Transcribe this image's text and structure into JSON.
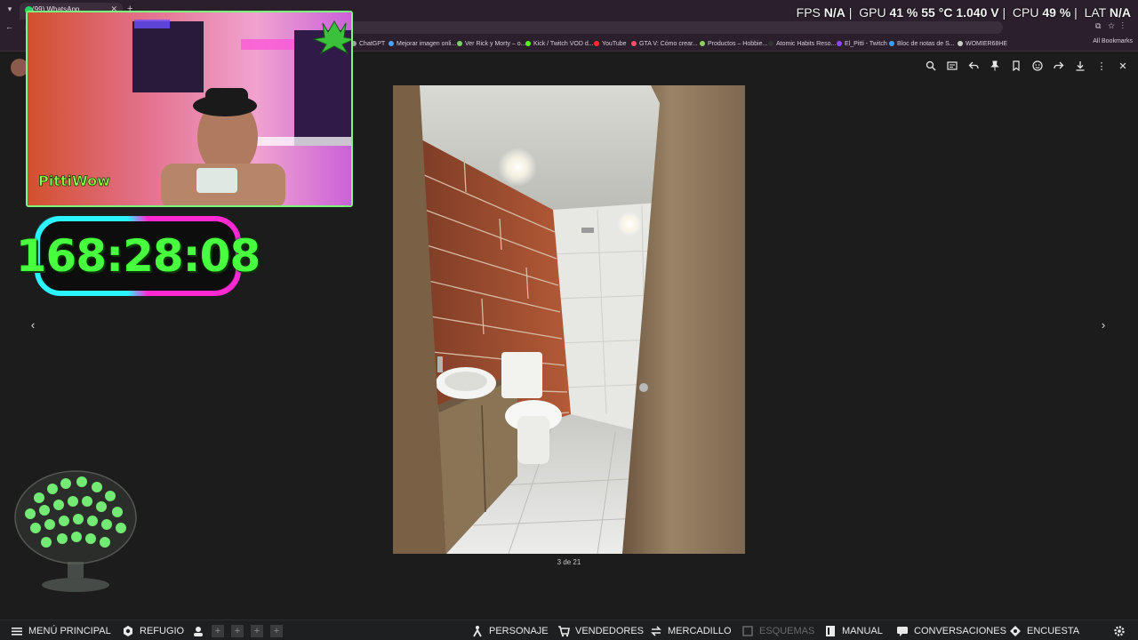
{
  "browser": {
    "tab_title": "(99) WhatsApp",
    "bookmarks": [
      {
        "label": "ChatGPT",
        "color": "#9aa0a6"
      },
      {
        "label": "Mejorar imagen onli...",
        "color": "#4aa3ff"
      },
      {
        "label": "Ver Rick y Morty – o...",
        "color": "#7ad36b"
      },
      {
        "label": "Kick / Twitch VOD d...",
        "color": "#53fc18"
      },
      {
        "label": "YouTube",
        "color": "#ff2b2b"
      },
      {
        "label": "GTA V: Cómo crear...",
        "color": "#ff4d6d"
      },
      {
        "label": "Productos – Hobbie...",
        "color": "#8bd15a"
      },
      {
        "label": "Atomic Habits Reso...",
        "color": "#333333"
      },
      {
        "label": "El_Pitti - Twitch",
        "color": "#9146ff"
      },
      {
        "label": "Bloc de notas de S...",
        "color": "#3aa0ff"
      },
      {
        "label": "WOMIER68HE",
        "color": "#cccccc"
      }
    ],
    "all_bookmarks": "All Bookmarks"
  },
  "stats": {
    "fps_label": "FPS",
    "fps_value": "N/A",
    "gpu_label": "GPU",
    "gpu_util": "41 %",
    "gpu_temp": "55 °C",
    "gpu_volt": "1.040 V",
    "cpu_label": "CPU",
    "cpu_util": "49 %",
    "lat_label": "LAT",
    "lat_value": "N/A"
  },
  "viewer": {
    "counter": "3 de 21",
    "toolbar_icons": [
      "zoom-icon",
      "caption-icon",
      "reply-icon",
      "pin-icon",
      "star-icon",
      "react-icon",
      "forward-icon",
      "download-icon",
      "menu-icon",
      "close-icon"
    ]
  },
  "timer": {
    "value": "168:28:08"
  },
  "webcam": {
    "logo_text": "PittiWow"
  },
  "hud": {
    "menu": "MENÚ PRINCIPAL",
    "refugio": "REFUGIO",
    "personaje": "PERSONAJE",
    "vendedores": "VENDEDORES",
    "mercadillo": "MERCADILLO",
    "esquemas": "ESQUEMAS",
    "manual": "MANUAL",
    "conversaciones": "CONVERSACIONES",
    "encuesta": "ENCUESTA"
  }
}
